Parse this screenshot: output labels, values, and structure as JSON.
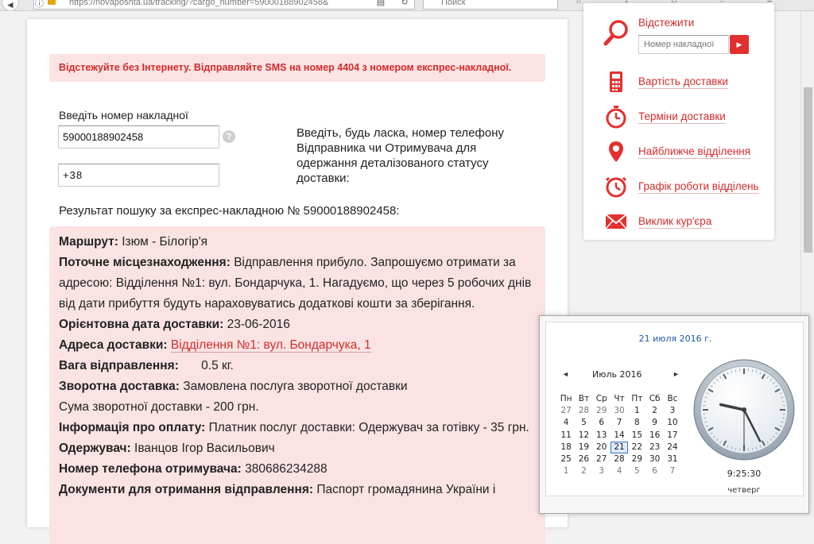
{
  "browser": {
    "url": "https://novaposhta.ua/tracking/?cargo_number=59000188902458&",
    "search_placeholder": "Поиск"
  },
  "banner": {
    "text": "Відстежуйте без Інтернету. Відправляйте SMS на номер 4404 з номером експрес-накладної."
  },
  "form": {
    "invoice_label": "Введіть номер накладної",
    "invoice_value": "59000188902458",
    "help_symbol": "?",
    "phone_value": "+38",
    "phone_hint": "Введіть, будь ласка, номер телефону Відправника чи Отримувача для одержання деталізованого статусу доставки:"
  },
  "result": {
    "title": "Результат пошуку за експрес-накладною № 59000188902458:",
    "route_label": "Маршрут:",
    "route_value": "Ізюм - Білогір'я",
    "location_label": "Поточне місцезнаходження:",
    "location_value": "Відправлення прибуло. Запрошуємо отримати за адресою: Відділення №1: вул. Бондарчука, 1. Нагадуємо, що через 5 робочих днів від дати прибуття будуть нараховуватись додаткові кошти за зберігання.",
    "date_label": "Орієнтовна дата доставки:",
    "date_value": "23-06-2016",
    "address_label": "Адреса доставки:",
    "address_value": "Відділення №1: вул. Бондарчука, 1",
    "weight_label": "Вага відправлення:",
    "weight_value": "0.5 кг.",
    "return_label": "Зворотна доставка:",
    "return_value": "Замовлена послуга зворотної доставки",
    "return_sum": "Сума зворотної доставки - 200 грн.",
    "payment_label": "Інформація про оплату:",
    "payment_value": "Платник послуг доставки: Одержувач за готівку - 35 грн.",
    "recipient_label": "Одержувач:",
    "recipient_value": "Іванцов Ігор Васильович",
    "phone_label": "Номер телефона отримувача:",
    "phone_value": "380686234288",
    "docs_label": "Документи для отримання відправлення:",
    "docs_value": "Паспорт громадянина України і"
  },
  "sidebar": {
    "track_title": "Відстежити",
    "track_placeholder": "Номер накладної",
    "items": [
      {
        "label": "Вартість доставки"
      },
      {
        "label": "Терміни доставки"
      },
      {
        "label": "Найближче відділення"
      },
      {
        "label": "Графік роботи відділень"
      },
      {
        "label": "Виклик кур'єра"
      }
    ]
  },
  "clock": {
    "date_link": "21 июля 2016 г.",
    "month": "Июль 2016",
    "prev": "◄",
    "next": "►",
    "weekdays": [
      "Пн",
      "Вт",
      "Ср",
      "Чт",
      "Пт",
      "Сб",
      "Вс"
    ],
    "days": [
      "27",
      "28",
      "29",
      "30",
      "1",
      "2",
      "3",
      "4",
      "5",
      "6",
      "7",
      "8",
      "9",
      "10",
      "11",
      "12",
      "13",
      "14",
      "15",
      "16",
      "17",
      "18",
      "19",
      "20",
      "21",
      "22",
      "23",
      "24",
      "25",
      "26",
      "27",
      "28",
      "29",
      "30",
      "31",
      "1",
      "2",
      "3",
      "4",
      "5",
      "6",
      "7"
    ],
    "today": "21",
    "time": "9:25:30",
    "day_name": "четверг",
    "hour": 9,
    "minute": 25,
    "second": 30
  },
  "colors": {
    "brand_red": "#d42b2b",
    "banner_bg": "#fbe3e3"
  }
}
